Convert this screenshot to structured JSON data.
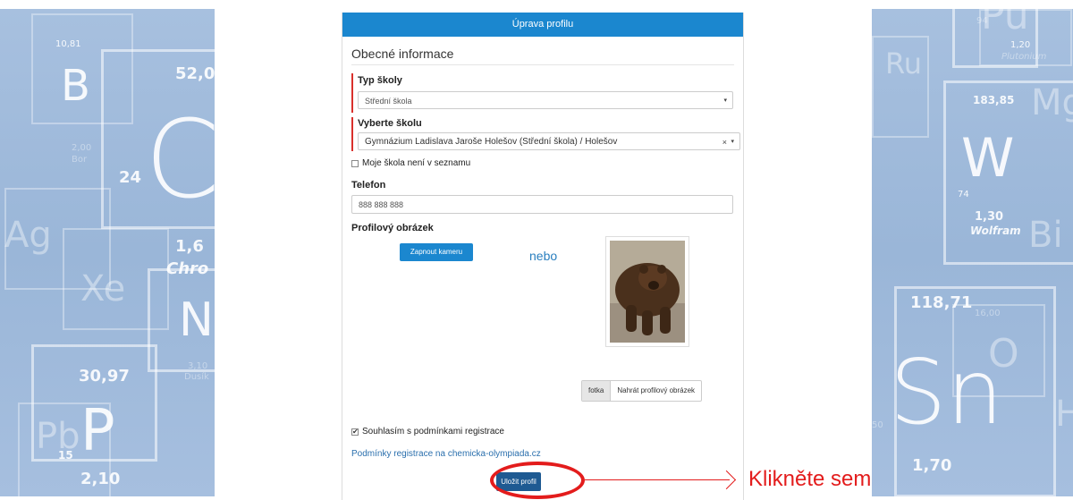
{
  "header": {
    "title": "Úprava profilu"
  },
  "section": {
    "title": "Obecné informace"
  },
  "school_type": {
    "label": "Typ školy",
    "value": "Střední škola"
  },
  "school": {
    "label": "Vyberte školu",
    "value": "Gymnázium Ladislava Jaroše Holešov (Střední škola) / Holešov",
    "clear": "×",
    "caret": "▾"
  },
  "not_listed": {
    "label": "Moje škola není v seznamu",
    "checked": false
  },
  "phone": {
    "label": "Telefon",
    "placeholder": "888 888 888"
  },
  "picture": {
    "label": "Profilový obrázek",
    "camera_button": "Zapnout kameru",
    "or_text": "nebo",
    "photo_tab": "fotka",
    "upload_button": "Nahrát profilový obrázek"
  },
  "consent": {
    "label": "Souhlasím s podmínkami registrace",
    "checked": true,
    "check_glyph": "✔"
  },
  "terms_link": "Podmínky registrace na chemicka-olympiada.cz",
  "save_button": "Uložit profil",
  "annotation": {
    "text": "Klikněte sem",
    "color": "#e31c1c"
  },
  "background_left": {
    "symbols": [
      "B",
      "C",
      "Ag",
      "Xe",
      "N",
      "P",
      "Pb"
    ],
    "numbers": [
      "10,81",
      "52,0",
      "24",
      "1,6",
      "30,97",
      "15",
      "2,10",
      "3,10",
      "2,00"
    ],
    "names": [
      "Bor",
      "Chro",
      "Dusík"
    ]
  },
  "background_right": {
    "symbols": [
      "Ru",
      "Pu",
      "W",
      "Mg",
      "Bi",
      "Sn",
      "O",
      "He"
    ],
    "numbers": [
      "183,85",
      "1,20",
      "94",
      "74",
      "1,30",
      "118,71",
      "16,00",
      "1,70",
      "50"
    ],
    "names": [
      "Plutonium",
      "Wolfram",
      "Sn"
    ]
  },
  "colors": {
    "header": "#1b87cf",
    "save": "#1e5a92",
    "background": "#a7c0df"
  }
}
